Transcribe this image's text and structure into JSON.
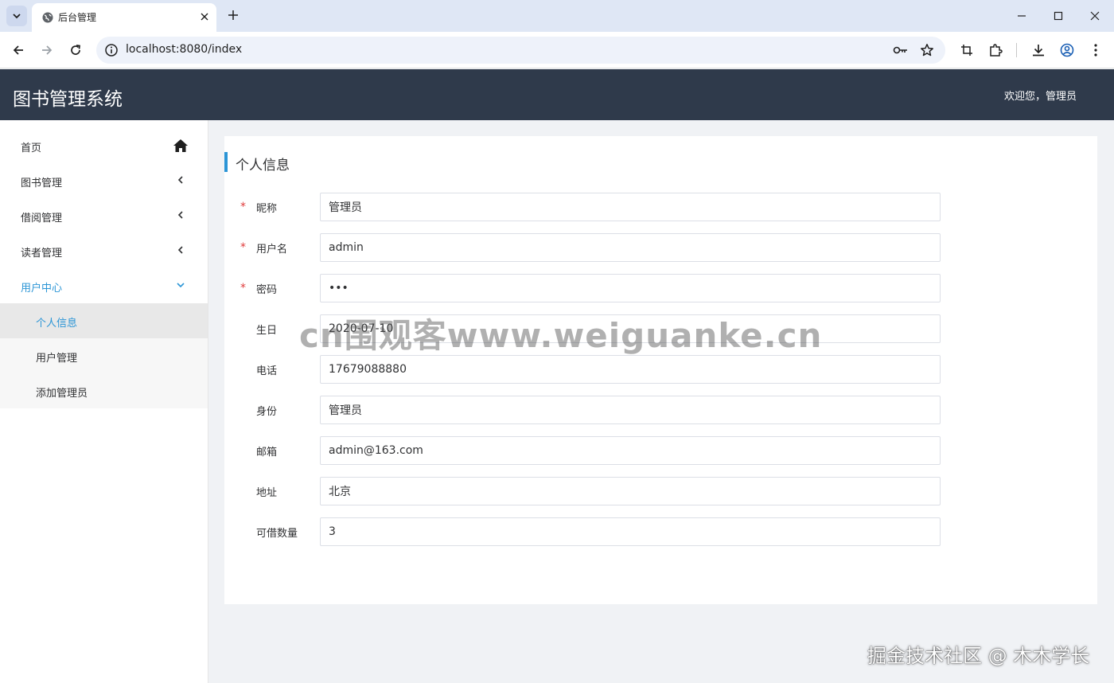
{
  "browser": {
    "tab_title": "后台管理",
    "url": "localhost:8080/index"
  },
  "header": {
    "app_title": "图书管理系统",
    "welcome": "欢迎您，管理员"
  },
  "sidebar": {
    "items": [
      {
        "label": "首页",
        "icon": "home-icon"
      },
      {
        "label": "图书管理",
        "icon": "chevron-left-icon"
      },
      {
        "label": "借阅管理",
        "icon": "chevron-left-icon"
      },
      {
        "label": "读者管理",
        "icon": "chevron-left-icon"
      },
      {
        "label": "用户中心",
        "icon": "chevron-down-icon",
        "expanded": true
      }
    ],
    "subitems": [
      {
        "label": "个人信息",
        "selected": true
      },
      {
        "label": "用户管理"
      },
      {
        "label": "添加管理员"
      }
    ],
    "active_color": "#2b95d6"
  },
  "card": {
    "title": "个人信息",
    "fields": [
      {
        "label": "昵称",
        "value": "管理员",
        "required": true
      },
      {
        "label": "用户名",
        "value": "admin",
        "required": true
      },
      {
        "label": "密码",
        "value": "•••",
        "required": true
      },
      {
        "label": "生日",
        "value": "2020-07-10",
        "required": false
      },
      {
        "label": "电话",
        "value": "17679088880",
        "required": false
      },
      {
        "label": "身份",
        "value": "管理员",
        "required": false
      },
      {
        "label": "邮箱",
        "value": "admin@163.com",
        "required": false
      },
      {
        "label": "地址",
        "value": "北京",
        "required": false
      },
      {
        "label": "可借数量",
        "value": "3",
        "required": false
      }
    ]
  },
  "watermarks": {
    "center": "cn围观客www.weiguanke.cn",
    "bottom_right": "掘金技术社区 @ 木木学长"
  },
  "colors": {
    "header_bg": "#2f3a4b",
    "accent": "#2b95d6",
    "required_star": "#e03c3c"
  }
}
